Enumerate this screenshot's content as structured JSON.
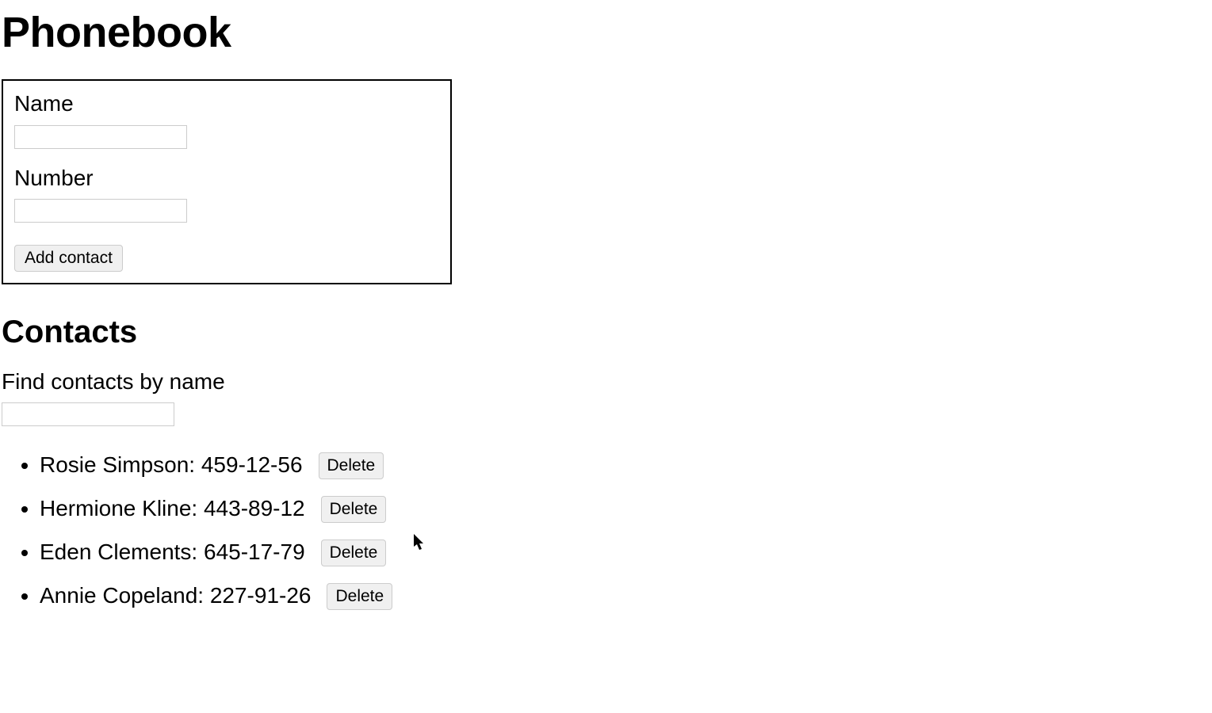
{
  "title": "Phonebook",
  "form": {
    "name_label": "Name",
    "name_value": "",
    "number_label": "Number",
    "number_value": "",
    "add_button": "Add contact"
  },
  "contacts_section": {
    "heading": "Contacts",
    "find_label": "Find contacts by name",
    "find_value": ""
  },
  "delete_label": "Delete",
  "contacts": [
    {
      "name": "Rosie Simpson",
      "number": "459-12-56"
    },
    {
      "name": "Hermione Kline",
      "number": "443-89-12"
    },
    {
      "name": "Eden Clements",
      "number": "645-17-79"
    },
    {
      "name": "Annie Copeland",
      "number": "227-91-26"
    }
  ]
}
